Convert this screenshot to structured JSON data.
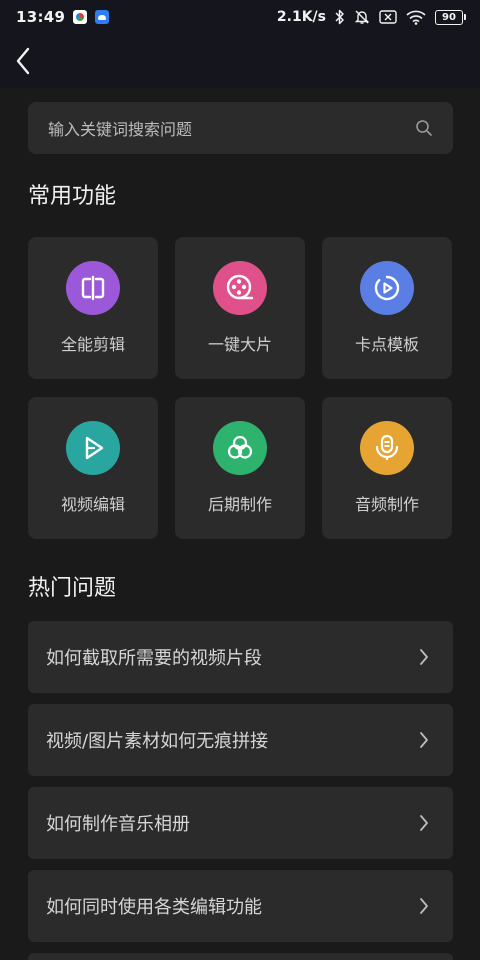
{
  "status_bar": {
    "time": "13:49",
    "net_speed": "2.1K/s",
    "battery": "90"
  },
  "search": {
    "placeholder": "输入关键词搜索问题"
  },
  "common": {
    "title": "常用功能",
    "tiles": [
      {
        "label": "全能剪辑",
        "icon": "full-edit-icon",
        "color": "#9b59d9"
      },
      {
        "label": "一键大片",
        "icon": "film-reel-icon",
        "color": "#e0508a"
      },
      {
        "label": "卡点模板",
        "icon": "beat-template-icon",
        "color": "#5b7ee5"
      },
      {
        "label": "视频编辑",
        "icon": "video-edit-icon",
        "color": "#2aa6a0"
      },
      {
        "label": "后期制作",
        "icon": "post-production-icon",
        "color": "#2db36e"
      },
      {
        "label": "音频制作",
        "icon": "audio-icon",
        "color": "#e6a532"
      }
    ]
  },
  "faq": {
    "title": "热门问题",
    "items": [
      {
        "label": "如何截取所需要的视频片段"
      },
      {
        "label": "视频/图片素材如何无痕拼接"
      },
      {
        "label": "如何制作音乐相册"
      },
      {
        "label": "如何同时使用各类编辑功能"
      }
    ]
  }
}
